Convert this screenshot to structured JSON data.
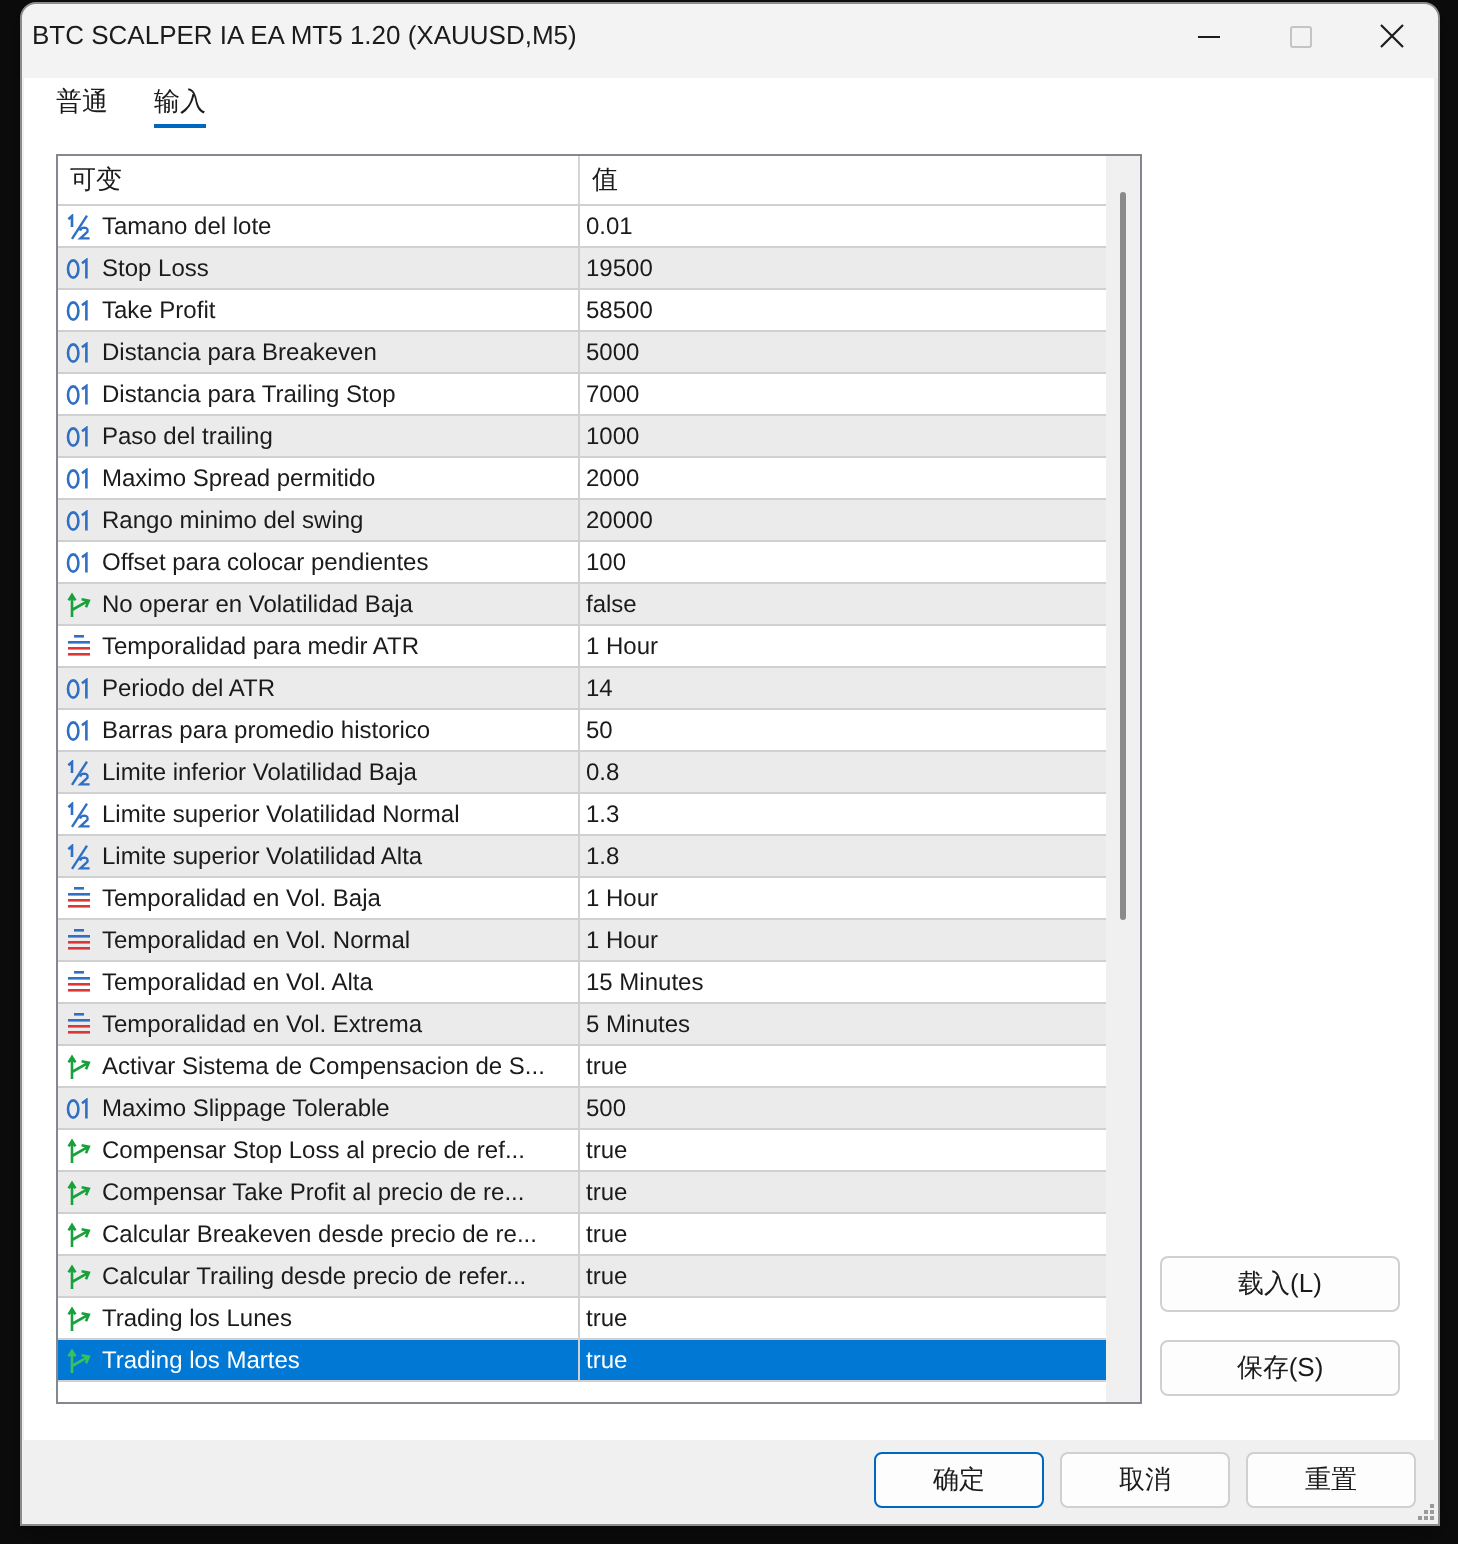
{
  "window": {
    "title": "BTC SCALPER IA EA MT5 1.20 (XAUUSD,M5)",
    "maximize_disabled": true
  },
  "tabs": [
    {
      "label": "普通",
      "selected": false
    },
    {
      "label": "输入",
      "selected": true
    }
  ],
  "table": {
    "columns": [
      "可变",
      "值"
    ],
    "rows": [
      {
        "kind": "double",
        "name": "Tamano del lote",
        "value": "0.01",
        "selected": false
      },
      {
        "kind": "int",
        "name": "Stop Loss",
        "value": "19500",
        "selected": false
      },
      {
        "kind": "int",
        "name": "Take Profit",
        "value": "58500",
        "selected": false
      },
      {
        "kind": "int",
        "name": "Distancia para Breakeven",
        "value": "5000",
        "selected": false
      },
      {
        "kind": "int",
        "name": "Distancia para Trailing Stop",
        "value": "7000",
        "selected": false
      },
      {
        "kind": "int",
        "name": "Paso del trailing",
        "value": "1000",
        "selected": false
      },
      {
        "kind": "int",
        "name": "Maximo Spread permitido",
        "value": "2000",
        "selected": false
      },
      {
        "kind": "int",
        "name": "Rango minimo del swing",
        "value": "20000",
        "selected": false
      },
      {
        "kind": "int",
        "name": "Offset para colocar pendientes",
        "value": "100",
        "selected": false
      },
      {
        "kind": "bool",
        "name": "No operar en Volatilidad Baja",
        "value": "false",
        "selected": false
      },
      {
        "kind": "enum",
        "name": "Temporalidad para medir ATR",
        "value": "1 Hour",
        "selected": false
      },
      {
        "kind": "int",
        "name": "Periodo del ATR",
        "value": "14",
        "selected": false
      },
      {
        "kind": "int",
        "name": "Barras para promedio historico",
        "value": "50",
        "selected": false
      },
      {
        "kind": "double",
        "name": "Limite inferior Volatilidad Baja",
        "value": "0.8",
        "selected": false
      },
      {
        "kind": "double",
        "name": "Limite superior Volatilidad Normal",
        "value": "1.3",
        "selected": false
      },
      {
        "kind": "double",
        "name": "Limite superior Volatilidad Alta",
        "value": "1.8",
        "selected": false
      },
      {
        "kind": "enum",
        "name": "Temporalidad en Vol. Baja",
        "value": "1 Hour",
        "selected": false
      },
      {
        "kind": "enum",
        "name": "Temporalidad en Vol. Normal",
        "value": "1 Hour",
        "selected": false
      },
      {
        "kind": "enum",
        "name": "Temporalidad en Vol. Alta",
        "value": "15 Minutes",
        "selected": false
      },
      {
        "kind": "enum",
        "name": "Temporalidad en Vol. Extrema",
        "value": "5 Minutes",
        "selected": false
      },
      {
        "kind": "bool",
        "name": "Activar Sistema de Compensacion de S...",
        "value": "true",
        "selected": false
      },
      {
        "kind": "int",
        "name": "Maximo Slippage Tolerable",
        "value": "500",
        "selected": false
      },
      {
        "kind": "bool",
        "name": "Compensar Stop Loss al precio de ref...",
        "value": "true",
        "selected": false
      },
      {
        "kind": "bool",
        "name": "Compensar Take Profit al precio de re...",
        "value": "true",
        "selected": false
      },
      {
        "kind": "bool",
        "name": "Calcular Breakeven desde precio de re...",
        "value": "true",
        "selected": false
      },
      {
        "kind": "bool",
        "name": "Calcular Trailing desde precio de refer...",
        "value": "true",
        "selected": false
      },
      {
        "kind": "bool",
        "name": "Trading los Lunes",
        "value": "true",
        "selected": false
      },
      {
        "kind": "bool",
        "name": "Trading los Martes",
        "value": "true",
        "selected": true
      }
    ]
  },
  "side_buttons": [
    "载入(L)",
    "保存(S)"
  ],
  "buttons": [
    {
      "label": "确定",
      "default": true
    },
    {
      "label": "取消",
      "default": false
    },
    {
      "label": "重置",
      "default": false
    }
  ]
}
